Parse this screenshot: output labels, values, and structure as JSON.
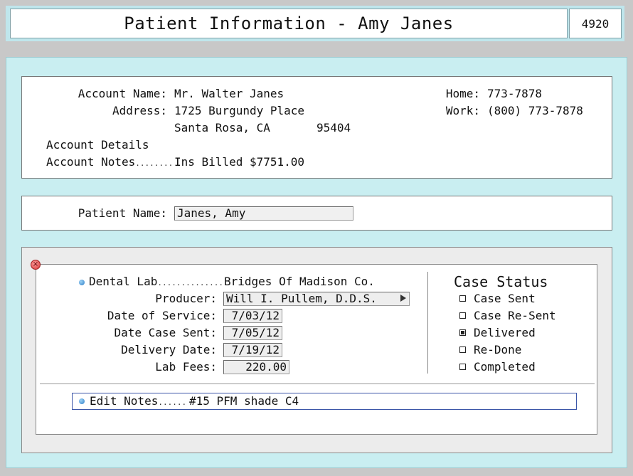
{
  "title": "Patient Information - Amy Janes",
  "record_number": "4920",
  "account": {
    "name_label": "Account Name:",
    "name_value": "Mr. Walter Janes",
    "address_label": "Address:",
    "address_line1": "1725 Burgundy Place",
    "city_state": "Santa Rosa, CA",
    "zip": "95404",
    "details_label": "Account Details",
    "notes_label": "Account Notes",
    "notes_value": "Ins Billed $7751.00",
    "home_label": "Home:",
    "home_value": "773-7878",
    "work_label": "Work:",
    "work_value": "(800) 773-7878"
  },
  "patient": {
    "label": "Patient Name:",
    "value": "Janes, Amy"
  },
  "lab": {
    "dental_lab_label": "Dental Lab",
    "dental_lab_value": "Bridges Of Madison Co.",
    "producer_label": "Producer:",
    "producer_value": "Will I. Pullem, D.D.S.",
    "service_label": "Date of Service:",
    "service_value": "7/03/12",
    "sent_label": "Date Case Sent:",
    "sent_value": "7/05/12",
    "delivery_label": "Delivery Date:",
    "delivery_value": "7/19/12",
    "fees_label": "Lab Fees:",
    "fees_value": "220.00",
    "notes_label": "Edit Notes",
    "notes_value": "#15 PFM shade C4"
  },
  "case_status": {
    "heading": "Case Status",
    "options": [
      {
        "label": "Case Sent",
        "checked": false
      },
      {
        "label": "Case Re-Sent",
        "checked": false
      },
      {
        "label": "Delivered",
        "checked": true
      },
      {
        "label": "Re-Done",
        "checked": false
      },
      {
        "label": "Completed",
        "checked": false
      }
    ]
  },
  "colors": {
    "background": "#c9eef1",
    "accent_border": "#3a55a8"
  }
}
